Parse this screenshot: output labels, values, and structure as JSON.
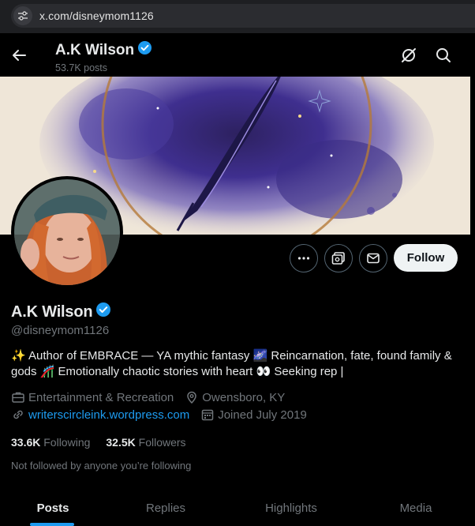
{
  "browser": {
    "url": "x.com/disneymom1126"
  },
  "header": {
    "name": "A.K Wilson",
    "posts": "53.7K posts"
  },
  "profile": {
    "name": "A.K Wilson",
    "handle": "@disneymom1126",
    "bio": "✨ Author of EMBRACE — YA mythic fantasy 🌌 Reincarnation, fate, found family & gods 🎢 Emotionally chaotic stories with heart 👀 Seeking rep |",
    "category": "Entertainment & Recreation",
    "location": "Owensboro, KY",
    "website": "writerscircleink.wordpress.com",
    "joined": "Joined July 2019",
    "following_count": "33.6K",
    "following_label": "Following",
    "followers_count": "32.5K",
    "followers_label": "Followers",
    "not_followed": "Not followed by anyone you’re following"
  },
  "actions": {
    "follow_label": "Follow"
  },
  "tabs": [
    {
      "label": "Posts",
      "active": true
    },
    {
      "label": "Replies",
      "active": false
    },
    {
      "label": "Highlights",
      "active": false
    },
    {
      "label": "Media",
      "active": false
    }
  ],
  "colors": {
    "accent": "#1d9bf0",
    "muted": "#71767b",
    "text": "#e7e9ea",
    "background": "#000000"
  },
  "icons": [
    "site-info-icon",
    "back-arrow-icon",
    "verified-badge-icon",
    "grok-icon",
    "search-icon",
    "more-icon",
    "subscribe-icon",
    "message-icon",
    "briefcase-icon",
    "location-icon",
    "link-icon",
    "calendar-icon"
  ]
}
